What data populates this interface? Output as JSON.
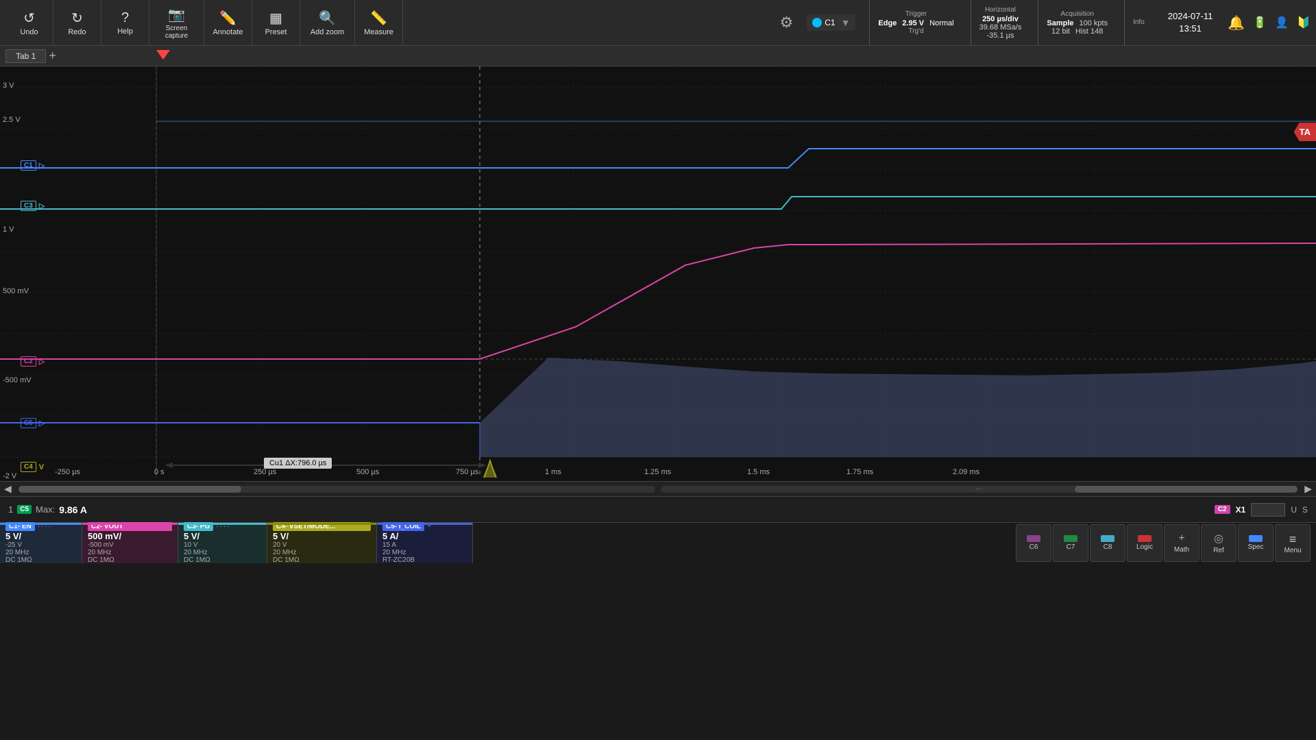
{
  "toolbar": {
    "undo_label": "Undo",
    "redo_label": "Redo",
    "help_label": "Help",
    "screen_capture_label": "Screen\ncapture",
    "annotate_label": "Annotate",
    "preset_label": "Preset",
    "add_zoom_label": "Add zoom",
    "measure_label": "Measure"
  },
  "trigger": {
    "title": "Trigger",
    "type": "Edge",
    "voltage": "2.95 V",
    "mode": "Normal",
    "status": "Trg'd"
  },
  "horizontal": {
    "title": "Horizontal",
    "time_div": "250 µs/div",
    "sample_rate": "39.68 MSa/s",
    "position": "-35.1 µs"
  },
  "acquisition": {
    "title": "Acquisition",
    "mode": "Sample",
    "points": "100 kpts",
    "bits": "12 bit",
    "hist": "Hist 148"
  },
  "info": {
    "title": "Info"
  },
  "datetime": "2024-07-11\n13:51",
  "tab": {
    "name": "Tab 1",
    "add_label": "+"
  },
  "y_labels": [
    "3 V",
    "2.5 V",
    "1 V",
    "500 mV",
    "-500 mV",
    "-2 V"
  ],
  "x_labels": [
    "-250 µs",
    "0 s",
    "250 µs",
    "500 µs",
    "750 µs",
    "1 ms",
    "1.25 ms",
    "1.5 ms",
    "1.75 ms",
    "2.09 ms"
  ],
  "channels": {
    "c1": {
      "label": "C1",
      "color": "#4488ff",
      "arrow": ">"
    },
    "c2": {
      "label": "C2",
      "color": "#dd44aa",
      "arrow": ">"
    },
    "c3": {
      "label": "C3",
      "color": "#44bbcc",
      "arrow": ">"
    },
    "c4": {
      "label": "C4",
      "color": "#aaaa22",
      "arrow": "V"
    },
    "c5": {
      "label": "C5",
      "color": "#4466ee",
      "arrow": ">"
    },
    "ta": {
      "label": "TA"
    }
  },
  "measurement": {
    "number": "1",
    "channel": "C5",
    "type": "Max:",
    "value": "9.86 A"
  },
  "cursor": {
    "label": "Cu1 ΔX:796.0 µs",
    "channel": "C2",
    "mode": "X1",
    "value": "",
    "unit_left": "U",
    "unit_right": "S"
  },
  "channel_strip": [
    {
      "id": "c1",
      "name": "C1- EN",
      "color": "#4488ff",
      "dots": "····",
      "voltage": "5 V/",
      "sub": "-25 V",
      "freq": "20 MHz",
      "imp": "DC 1MΩ"
    },
    {
      "id": "c2",
      "name": "C2- VOUT",
      "color": "#dd44aa",
      "dots": "",
      "voltage": "500 mV/",
      "sub": "-500 mV",
      "freq": "20 MHz",
      "imp": "DC 1MΩ"
    },
    {
      "id": "c3",
      "name": "C3- PG",
      "color": "#44bbcc",
      "dots": "····",
      "voltage": "5 V/",
      "sub": "10 V",
      "freq": "20 MHz",
      "imp": "DC 1MΩ"
    },
    {
      "id": "c4",
      "name": "C4- VSET/MODE...",
      "color": "#aaaa22",
      "dots": "",
      "voltage": "5 V/",
      "sub": "20 V",
      "freq": "20 MHz",
      "imp": "DC 1MΩ"
    },
    {
      "id": "c5",
      "name": "C5- I_COIL",
      "color": "#4466ee",
      "dots": "−",
      "voltage": "5 A/",
      "sub": "15 A",
      "freq": "20 MHz",
      "imp": "RT-ZC20B"
    }
  ],
  "right_buttons": [
    {
      "id": "c6",
      "label": "C6",
      "color": "#884488"
    },
    {
      "id": "c7",
      "label": "C7",
      "color": "#228844"
    },
    {
      "id": "c8",
      "label": "C8",
      "color": "#44aacc"
    },
    {
      "id": "logic",
      "label": "Logic",
      "color": "#cc3333"
    },
    {
      "id": "math",
      "label": "Math",
      "color": "#aaaaaa"
    },
    {
      "id": "ref",
      "label": "Ref",
      "color": "#aaaaaa"
    },
    {
      "id": "spec",
      "label": "Spec",
      "color": "#4488ff"
    },
    {
      "id": "menu",
      "label": "Menu",
      "color": "#aaaaaa",
      "icon": "≡"
    }
  ]
}
